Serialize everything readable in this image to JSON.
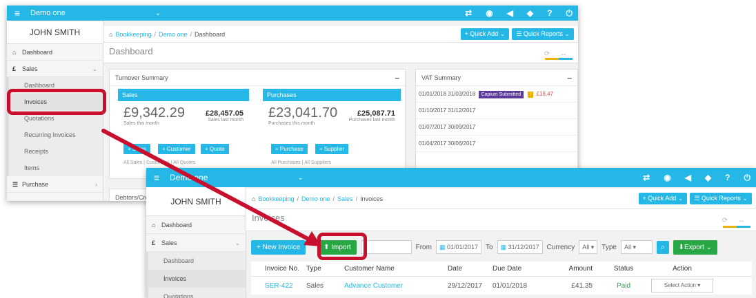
{
  "screen1": {
    "company": "Demo one",
    "user": "JOHN SMITH",
    "breadcrumb": [
      "Bookkeeping",
      "Demo one",
      "Dashboard"
    ],
    "quick_add": "Quick Add",
    "quick_reports": "Quick Reports",
    "page_title": "Dashboard",
    "nav": {
      "dashboard": "Dashboard",
      "sales": "Sales",
      "sales_items": [
        "Dashboard",
        "Invoices",
        "Quotations",
        "Recurring Invoices",
        "Receipts",
        "Items"
      ],
      "purchase": "Purchase"
    },
    "turnover": {
      "title": "Turnover Summary",
      "sales_title": "Sales",
      "sales_this_month": "£9,342.29",
      "sales_this_month_label": "Sales this month",
      "sales_last_month": "£28,457.05",
      "sales_last_month_label": "Sales last month",
      "sales_buttons": [
        "Sales",
        "Customer",
        "Quote"
      ],
      "sales_links": [
        "All Sales",
        "Customers",
        "All Quotes"
      ],
      "purchases_title": "Purchases",
      "purchases_this_month": "£23,041.70",
      "purchases_this_month_label": "Purchases this month",
      "purchases_last_month": "£25,087.71",
      "purchases_last_month_label": "Purchases last month",
      "purchase_buttons": [
        "Purchase",
        "Supplier"
      ],
      "purchase_links": [
        "All Purchases",
        "All Suppliers"
      ]
    },
    "vat": {
      "title": "VAT Summary",
      "rows": [
        {
          "from": "01/01/2018",
          "to": "31/03/2018",
          "badge": "Capium Submitted",
          "amount": "£18,47"
        },
        {
          "from": "01/10/2017",
          "to": "31/12/2017"
        },
        {
          "from": "01/07/2017",
          "to": "30/09/2017"
        },
        {
          "from": "01/04/2017",
          "to": "30/06/2017"
        }
      ]
    },
    "debtors": "Debtors/Cre"
  },
  "screen2": {
    "company": "Demo one",
    "user": "JOHN SMITH",
    "breadcrumb": [
      "Bookkeeping",
      "Demo one",
      "Sales",
      "Invoices"
    ],
    "quick_add": "Quick Add",
    "quick_reports": "Quick Reports",
    "page_title": "Invoices",
    "nav": {
      "dashboard": "Dashboard",
      "sales": "Sales",
      "sales_items": [
        "Dashboard",
        "Invoices",
        "Quotations"
      ]
    },
    "toolbar": {
      "new_invoice": "New Invoice",
      "import": "Import",
      "from_label": "From",
      "from_date": "01/01/2017",
      "to_label": "To",
      "to_date": "31/12/2017",
      "currency_label": "Currency",
      "currency_value": "All",
      "type_label": "Type",
      "type_value": "All",
      "export": "Export"
    },
    "table": {
      "headers": [
        "Invoice No.",
        "Type",
        "Customer Name",
        "Date",
        "Due Date",
        "Amount",
        "Status",
        "Action"
      ],
      "rows": [
        {
          "invoice_no": "SER-422",
          "type": "Sales",
          "customer": "Advance Customer",
          "date": "29/12/2017",
          "due": "01/01/2018",
          "amount": "£41.35",
          "status": "Paid",
          "action": "Select Action"
        }
      ]
    }
  },
  "colors": {
    "brand": "#25b8e6",
    "highlight": "#c8102e",
    "success": "#28a745",
    "badge": "#5b3a9a"
  }
}
